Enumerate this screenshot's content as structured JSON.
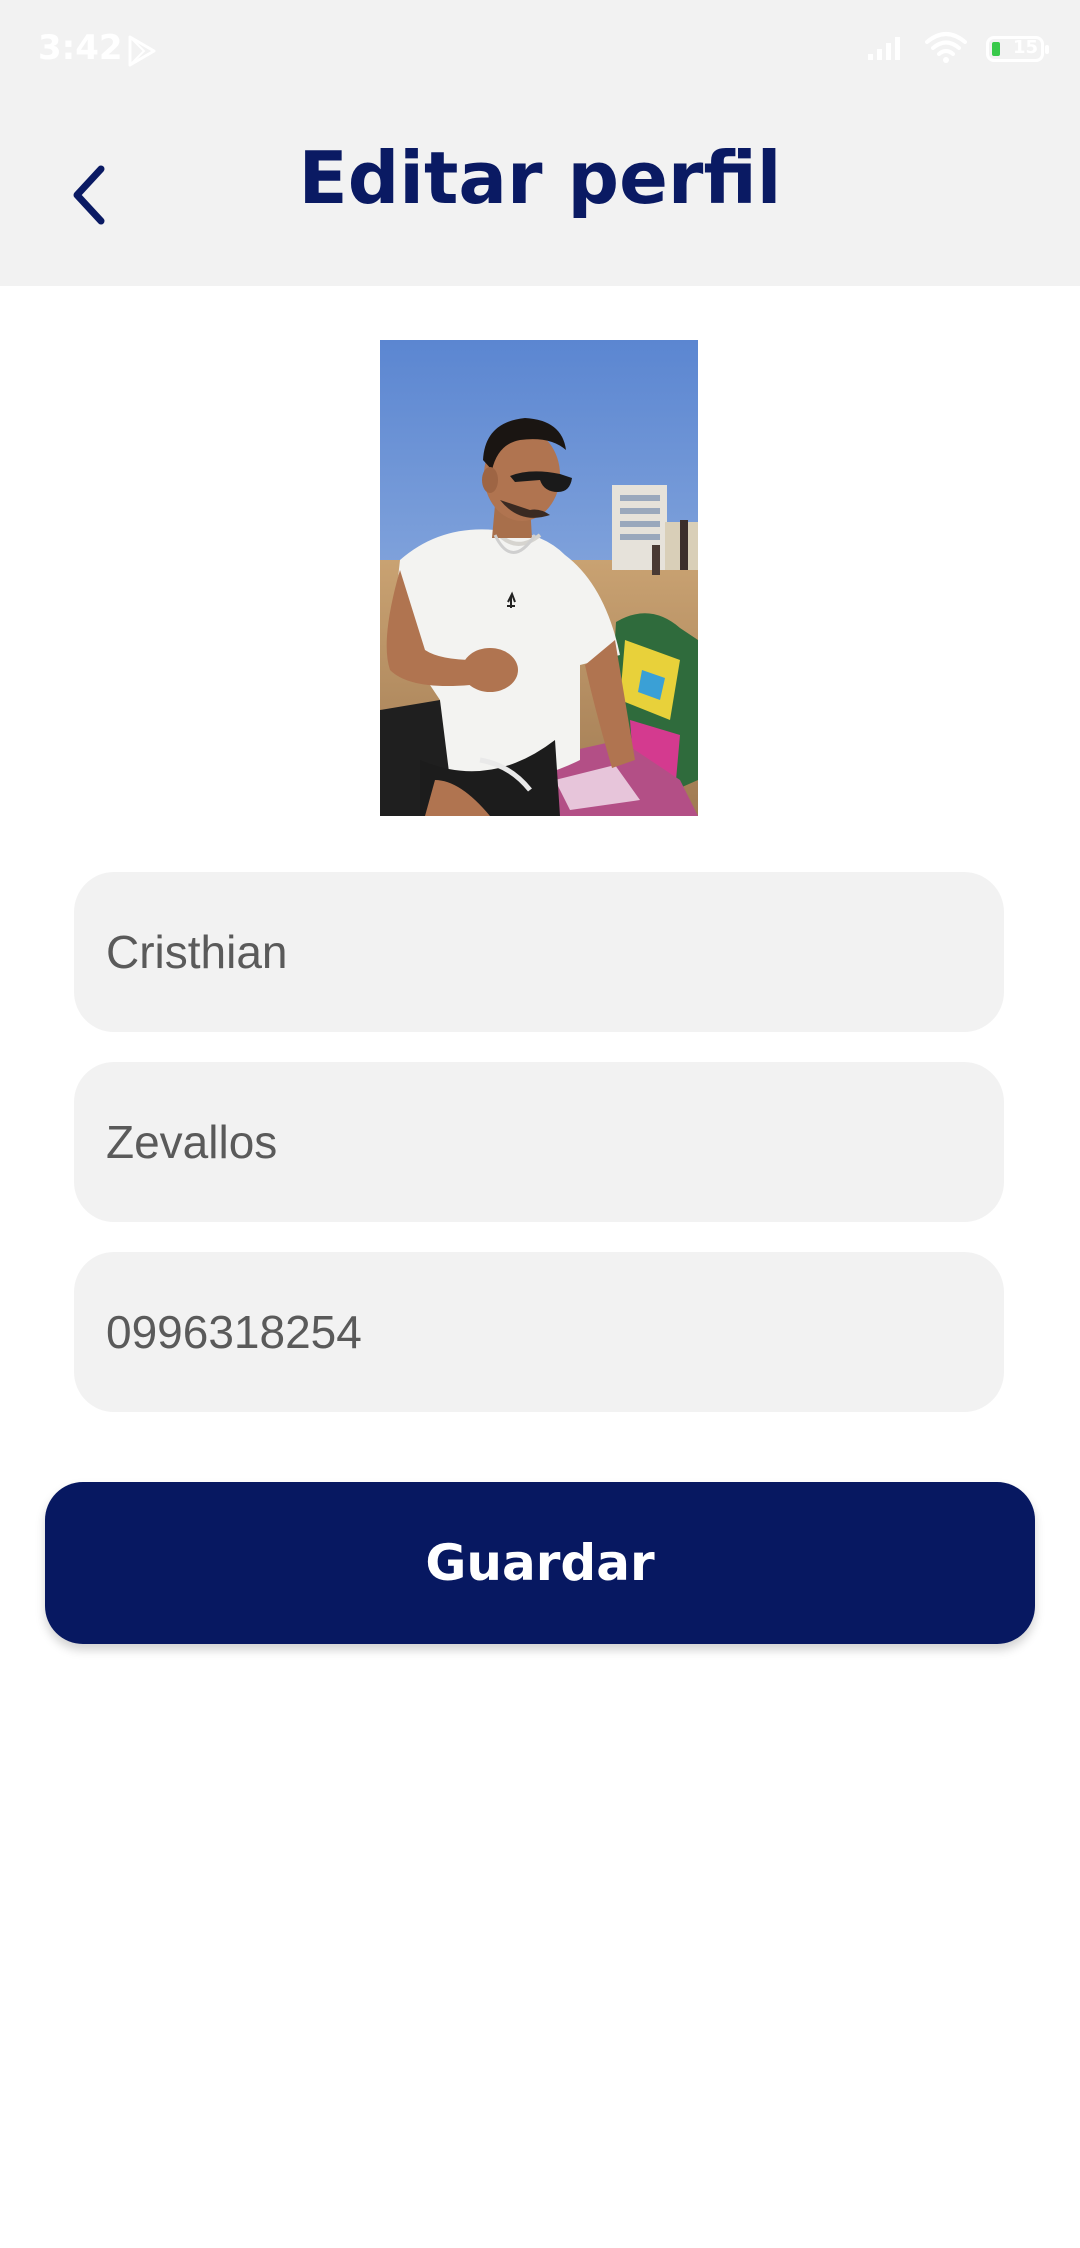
{
  "status_bar": {
    "time": "3:42",
    "battery_level": "15"
  },
  "header": {
    "title": "Editar perfil",
    "back_icon": "chevron-left-icon"
  },
  "profile": {
    "photo_alt": "Foto de perfil"
  },
  "form": {
    "first_name": "Cristhian",
    "last_name": "Zevallos",
    "phone": "0996318254"
  },
  "actions": {
    "save_label": "Guardar"
  },
  "colors": {
    "primary": "#071861",
    "title": "#0a1a63",
    "field_bg": "#f2f2f2",
    "header_bg": "#f2f2f2"
  }
}
